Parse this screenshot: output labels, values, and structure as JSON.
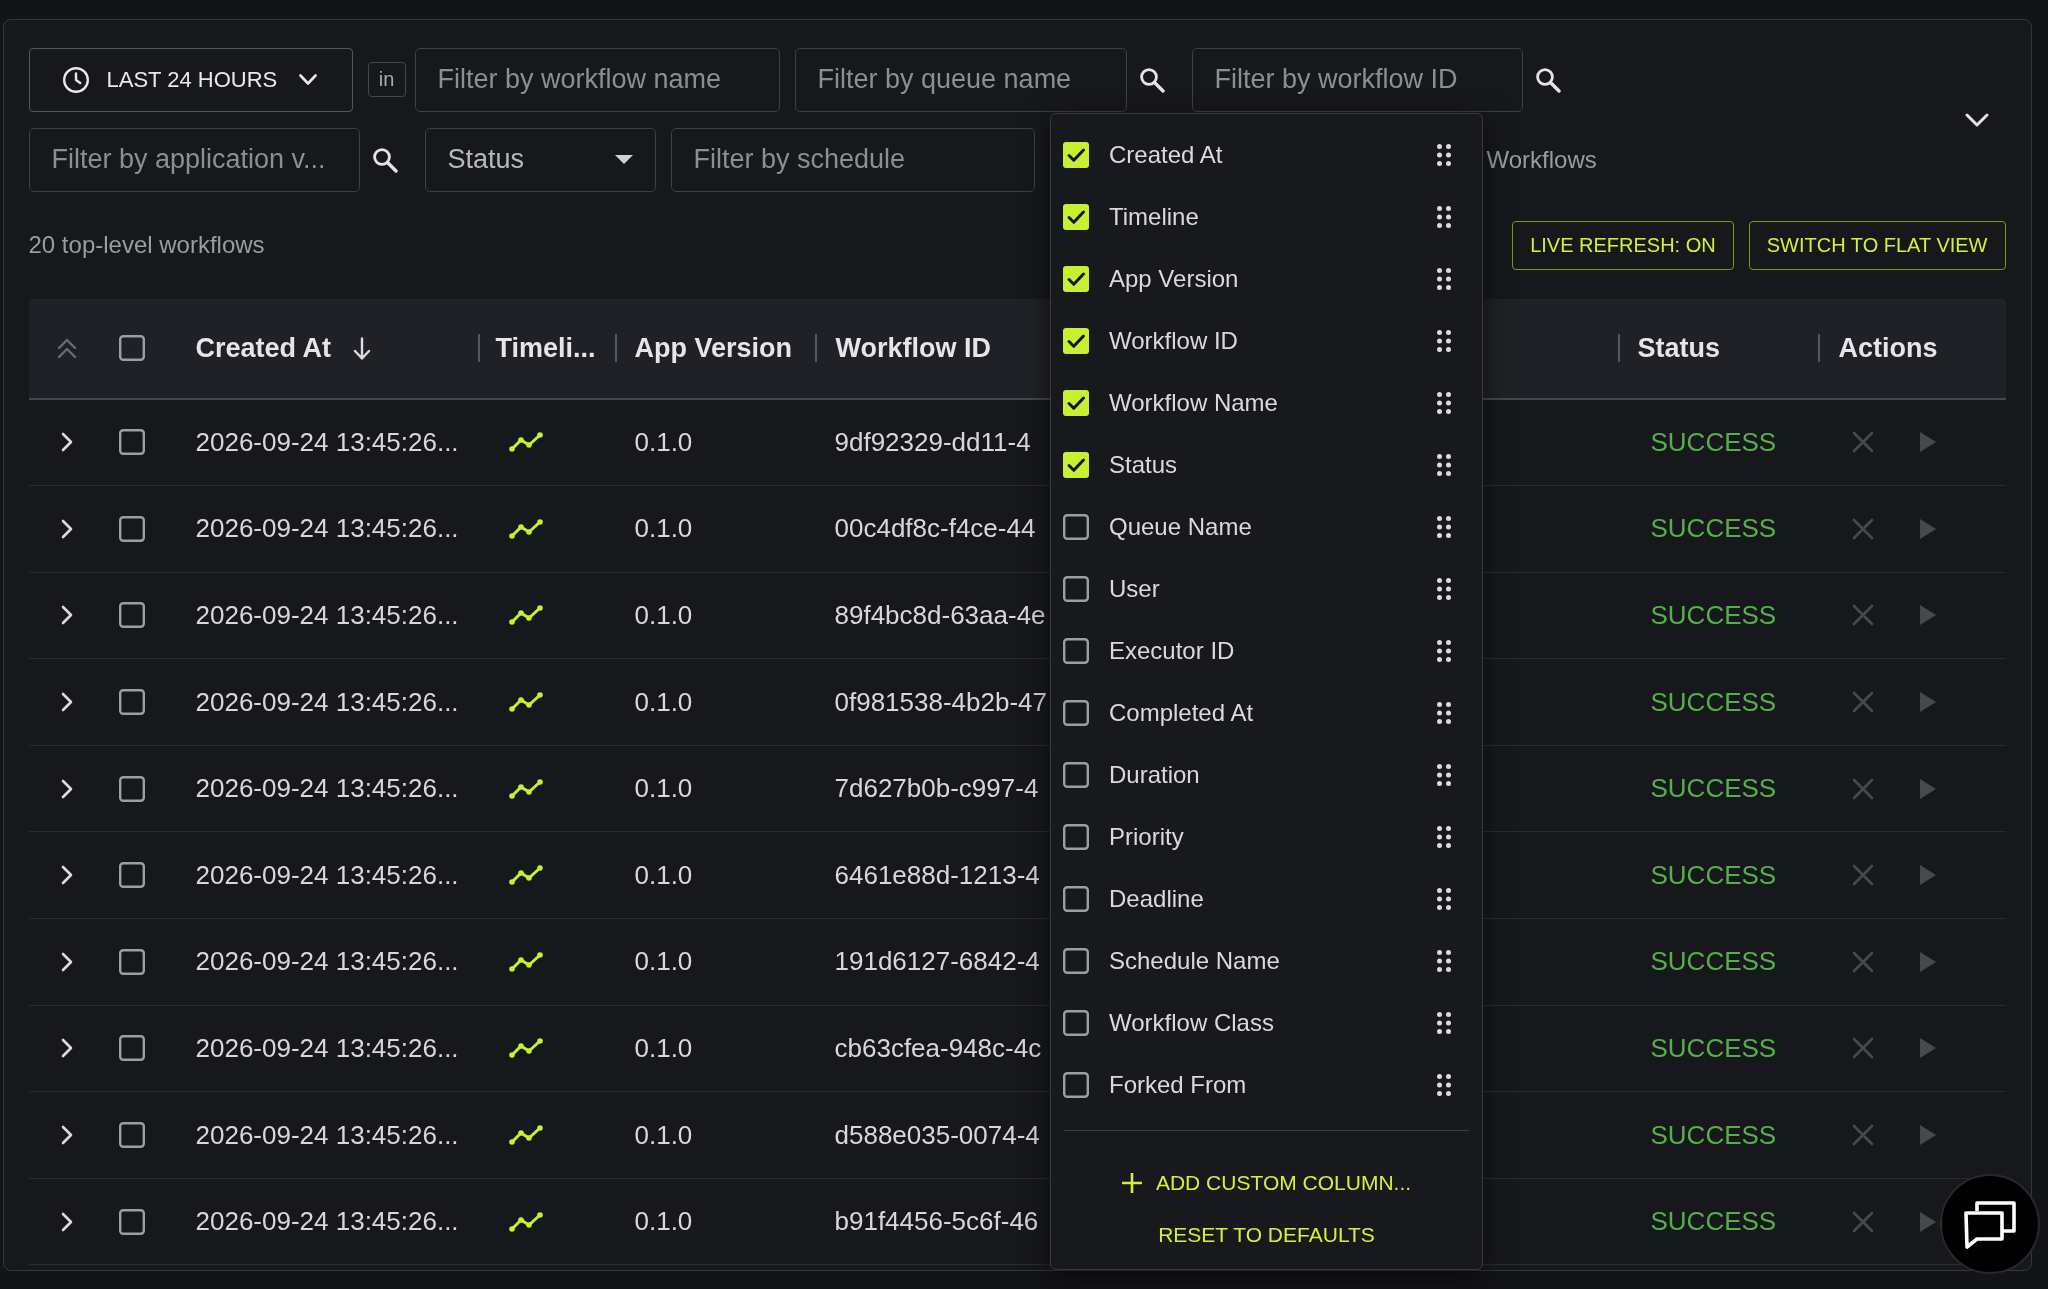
{
  "filter_bar": {
    "time_range": {
      "label": "LAST 24 HOURS"
    },
    "scope_tag": "in",
    "row_1": [
      {
        "kind": "input",
        "placeholder": "Filter by workflow name"
      },
      {
        "kind": "input",
        "placeholder": "Filter by queue name",
        "search_button": true
      },
      {
        "kind": "input",
        "placeholder": "Filter by workflow ID",
        "search_button": true
      }
    ],
    "row_2": [
      {
        "kind": "input",
        "placeholder": "Filter by application v...",
        "search_button": true
      },
      {
        "kind": "select",
        "label": "Status"
      },
      {
        "kind": "input",
        "placeholder": "Filter by schedule"
      },
      {
        "kind": "label",
        "text": "Workflows"
      }
    ]
  },
  "toolbar": {
    "summary": "20 top-level workflows",
    "buttons": [
      {
        "label": "LIVE REFRESH: ON"
      },
      {
        "label": "SWITCH TO FLAT VIEW"
      }
    ]
  },
  "table": {
    "all_selected": false,
    "columns": [
      {
        "label": "Created At",
        "sorted": true
      },
      {
        "label": "Timeli..."
      },
      {
        "label": "App Version"
      },
      {
        "label": "Workflow ID"
      },
      {
        "label": "Status"
      },
      {
        "label": "Actions"
      }
    ],
    "rows": [
      {
        "expanded": false,
        "selected": false,
        "created_at": "2026-09-24 13:45:26...",
        "app_version": "0.1.0",
        "workflow_id": "9df92329-dd11-4",
        "status": "SUCCESS",
        "actions_disabled": true
      },
      {
        "expanded": false,
        "selected": false,
        "created_at": "2026-09-24 13:45:26...",
        "app_version": "0.1.0",
        "workflow_id": "00c4df8c-f4ce-44",
        "status": "SUCCESS",
        "actions_disabled": true
      },
      {
        "expanded": false,
        "selected": false,
        "created_at": "2026-09-24 13:45:26...",
        "app_version": "0.1.0",
        "workflow_id": "89f4bc8d-63aa-4e",
        "status": "SUCCESS",
        "actions_disabled": true
      },
      {
        "expanded": false,
        "selected": false,
        "created_at": "2026-09-24 13:45:26...",
        "app_version": "0.1.0",
        "workflow_id": "0f981538-4b2b-47",
        "status": "SUCCESS",
        "actions_disabled": true
      },
      {
        "expanded": false,
        "selected": false,
        "created_at": "2026-09-24 13:45:26...",
        "app_version": "0.1.0",
        "workflow_id": "7d627b0b-c997-4",
        "status": "SUCCESS",
        "actions_disabled": true
      },
      {
        "expanded": false,
        "selected": false,
        "created_at": "2026-09-24 13:45:26...",
        "app_version": "0.1.0",
        "workflow_id": "6461e88d-1213-4",
        "status": "SUCCESS",
        "actions_disabled": true
      },
      {
        "expanded": false,
        "selected": false,
        "created_at": "2026-09-24 13:45:26...",
        "app_version": "0.1.0",
        "workflow_id": "191d6127-6842-4",
        "status": "SUCCESS",
        "actions_disabled": true
      },
      {
        "expanded": false,
        "selected": false,
        "created_at": "2026-09-24 13:45:26...",
        "app_version": "0.1.0",
        "workflow_id": "cb63cfea-948c-4c",
        "status": "SUCCESS",
        "actions_disabled": true
      },
      {
        "expanded": false,
        "selected": false,
        "created_at": "2026-09-24 13:45:26...",
        "app_version": "0.1.0",
        "workflow_id": "d588e035-0074-4",
        "status": "SUCCESS",
        "actions_disabled": true
      },
      {
        "expanded": false,
        "selected": false,
        "created_at": "2026-09-24 13:45:26...",
        "app_version": "0.1.0",
        "workflow_id": "b91f4456-5c6f-46",
        "status": "SUCCESS",
        "actions_disabled": true
      }
    ]
  },
  "column_menu": {
    "items": [
      {
        "label": "Created At",
        "checked": true
      },
      {
        "label": "Timeline",
        "checked": true
      },
      {
        "label": "App Version",
        "checked": true
      },
      {
        "label": "Workflow ID",
        "checked": true
      },
      {
        "label": "Workflow Name",
        "checked": true
      },
      {
        "label": "Status",
        "checked": true
      },
      {
        "label": "Queue Name",
        "checked": false
      },
      {
        "label": "User",
        "checked": false
      },
      {
        "label": "Executor ID",
        "checked": false
      },
      {
        "label": "Completed At",
        "checked": false
      },
      {
        "label": "Duration",
        "checked": false
      },
      {
        "label": "Priority",
        "checked": false
      },
      {
        "label": "Deadline",
        "checked": false
      },
      {
        "label": "Schedule Name",
        "checked": false
      },
      {
        "label": "Workflow Class",
        "checked": false
      },
      {
        "label": "Forked From",
        "checked": false
      }
    ],
    "actions": [
      {
        "kind": "add",
        "label": "ADD CUSTOM COLUMN..."
      },
      {
        "kind": "reset",
        "label": "RESET TO DEFAULTS"
      }
    ]
  }
}
